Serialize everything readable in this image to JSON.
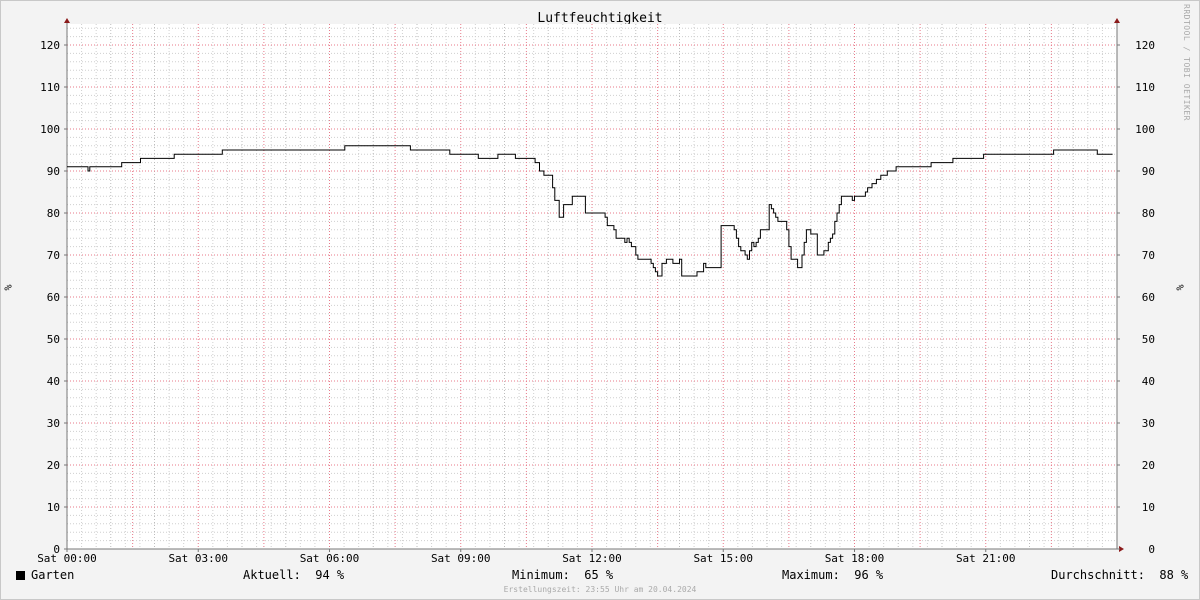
{
  "title": "Luftfeuchtigkeit",
  "watermark": "RRDTOOL / TOBI OETIKER",
  "footer": "Erstellungszeit: 23:55 Uhr am 20.04.2024",
  "colors": {
    "background": "#f3f3f3",
    "plot_background": "#ffffff",
    "major_grid": "#e87a8a",
    "minor_grid": "#cfcfcf",
    "line": "#000000",
    "axis_arrow": "#8b1a1a"
  },
  "legend": {
    "series_name": "Garten",
    "current_label": "Aktuell:",
    "current_value": "94 %",
    "min_label": "Minimum:",
    "min_value": "65 %",
    "max_label": "Maximum:",
    "max_value": "96 %",
    "avg_label": "Durchschnitt:",
    "avg_value": "88 %"
  },
  "chart_data": {
    "type": "line",
    "title": "Luftfeuchtigkeit",
    "ylabel": "%",
    "ylabel_right": "%",
    "xlim": [
      0,
      24
    ],
    "ylim": [
      0,
      125
    ],
    "y_ticks": [
      0,
      10,
      20,
      30,
      40,
      50,
      60,
      70,
      80,
      90,
      100,
      110,
      120
    ],
    "x_ticks": [
      {
        "value": 0,
        "label": "Sat 00:00"
      },
      {
        "value": 3,
        "label": "Sat 03:00"
      },
      {
        "value": 6,
        "label": "Sat 06:00"
      },
      {
        "value": 9,
        "label": "Sat 09:00"
      },
      {
        "value": 12,
        "label": "Sat 12:00"
      },
      {
        "value": 15,
        "label": "Sat 15:00"
      },
      {
        "value": 18,
        "label": "Sat 18:00"
      },
      {
        "value": 21,
        "label": "Sat 21:00"
      }
    ],
    "grid": true,
    "series": [
      {
        "name": "Garten",
        "points": [
          [
            0,
            91
          ],
          [
            0.45,
            91
          ],
          [
            0.48,
            90
          ],
          [
            0.52,
            91
          ],
          [
            1.2,
            91
          ],
          [
            1.25,
            92
          ],
          [
            1.6,
            92
          ],
          [
            1.68,
            93
          ],
          [
            2.4,
            93
          ],
          [
            2.45,
            94
          ],
          [
            3.5,
            94
          ],
          [
            3.55,
            95
          ],
          [
            5.3,
            95
          ],
          [
            6.3,
            95
          ],
          [
            6.35,
            96
          ],
          [
            7.8,
            96
          ],
          [
            7.85,
            95
          ],
          [
            8.7,
            95
          ],
          [
            8.75,
            94
          ],
          [
            9.3,
            94
          ],
          [
            9.4,
            93
          ],
          [
            9.8,
            93
          ],
          [
            9.85,
            94
          ],
          [
            10.2,
            94
          ],
          [
            10.25,
            93
          ],
          [
            10.6,
            93
          ],
          [
            10.7,
            92
          ],
          [
            10.8,
            90
          ],
          [
            10.9,
            89
          ],
          [
            11.0,
            89
          ],
          [
            11.1,
            86
          ],
          [
            11.15,
            83
          ],
          [
            11.2,
            83
          ],
          [
            11.25,
            79
          ],
          [
            11.3,
            79
          ],
          [
            11.35,
            82
          ],
          [
            11.5,
            82
          ],
          [
            11.55,
            84
          ],
          [
            11.8,
            84
          ],
          [
            11.85,
            80
          ],
          [
            12.2,
            80
          ],
          [
            12.3,
            79
          ],
          [
            12.35,
            77
          ],
          [
            12.5,
            76
          ],
          [
            12.55,
            74
          ],
          [
            12.7,
            74
          ],
          [
            12.75,
            73
          ],
          [
            12.8,
            74
          ],
          [
            12.85,
            73
          ],
          [
            12.9,
            72
          ],
          [
            13.0,
            70
          ],
          [
            13.05,
            69
          ],
          [
            13.3,
            69
          ],
          [
            13.35,
            68
          ],
          [
            13.4,
            67
          ],
          [
            13.45,
            66
          ],
          [
            13.5,
            65
          ],
          [
            13.55,
            65
          ],
          [
            13.6,
            68
          ],
          [
            13.7,
            69
          ],
          [
            13.8,
            69
          ],
          [
            13.85,
            68
          ],
          [
            14.0,
            69
          ],
          [
            14.05,
            65
          ],
          [
            14.3,
            65
          ],
          [
            14.4,
            66
          ],
          [
            14.5,
            66
          ],
          [
            14.55,
            68
          ],
          [
            14.6,
            67
          ],
          [
            14.9,
            67
          ],
          [
            14.95,
            77
          ],
          [
            15.2,
            77
          ],
          [
            15.25,
            76
          ],
          [
            15.3,
            74
          ],
          [
            15.35,
            72
          ],
          [
            15.4,
            71
          ],
          [
            15.5,
            70
          ],
          [
            15.55,
            69
          ],
          [
            15.6,
            71
          ],
          [
            15.65,
            73
          ],
          [
            15.7,
            72
          ],
          [
            15.75,
            73
          ],
          [
            15.8,
            74
          ],
          [
            15.85,
            76
          ],
          [
            16.0,
            76
          ],
          [
            16.05,
            82
          ],
          [
            16.1,
            81
          ],
          [
            16.15,
            80
          ],
          [
            16.2,
            79
          ],
          [
            16.25,
            78
          ],
          [
            16.4,
            78
          ],
          [
            16.45,
            76
          ],
          [
            16.5,
            72
          ],
          [
            16.55,
            69
          ],
          [
            16.65,
            69
          ],
          [
            16.7,
            67
          ],
          [
            16.75,
            67
          ],
          [
            16.8,
            70
          ],
          [
            16.85,
            73
          ],
          [
            16.9,
            76
          ],
          [
            16.95,
            76
          ],
          [
            17.0,
            75
          ],
          [
            17.1,
            75
          ],
          [
            17.15,
            70
          ],
          [
            17.3,
            71
          ],
          [
            17.4,
            73
          ],
          [
            17.45,
            74
          ],
          [
            17.5,
            75
          ],
          [
            17.55,
            78
          ],
          [
            17.6,
            80
          ],
          [
            17.65,
            82
          ],
          [
            17.7,
            84
          ],
          [
            17.9,
            84
          ],
          [
            17.95,
            83
          ],
          [
            18.0,
            84
          ],
          [
            18.2,
            84
          ],
          [
            18.25,
            85
          ],
          [
            18.3,
            86
          ],
          [
            18.4,
            87
          ],
          [
            18.5,
            88
          ],
          [
            18.6,
            89
          ],
          [
            18.7,
            89
          ],
          [
            18.75,
            90
          ],
          [
            18.9,
            90
          ],
          [
            18.95,
            91
          ],
          [
            19.7,
            91
          ],
          [
            19.75,
            92
          ],
          [
            20.2,
            92
          ],
          [
            20.25,
            93
          ],
          [
            20.9,
            93
          ],
          [
            20.95,
            94
          ],
          [
            22.5,
            94
          ],
          [
            22.55,
            95
          ],
          [
            23.5,
            95
          ],
          [
            23.55,
            94
          ],
          [
            23.9,
            94
          ]
        ]
      }
    ]
  }
}
